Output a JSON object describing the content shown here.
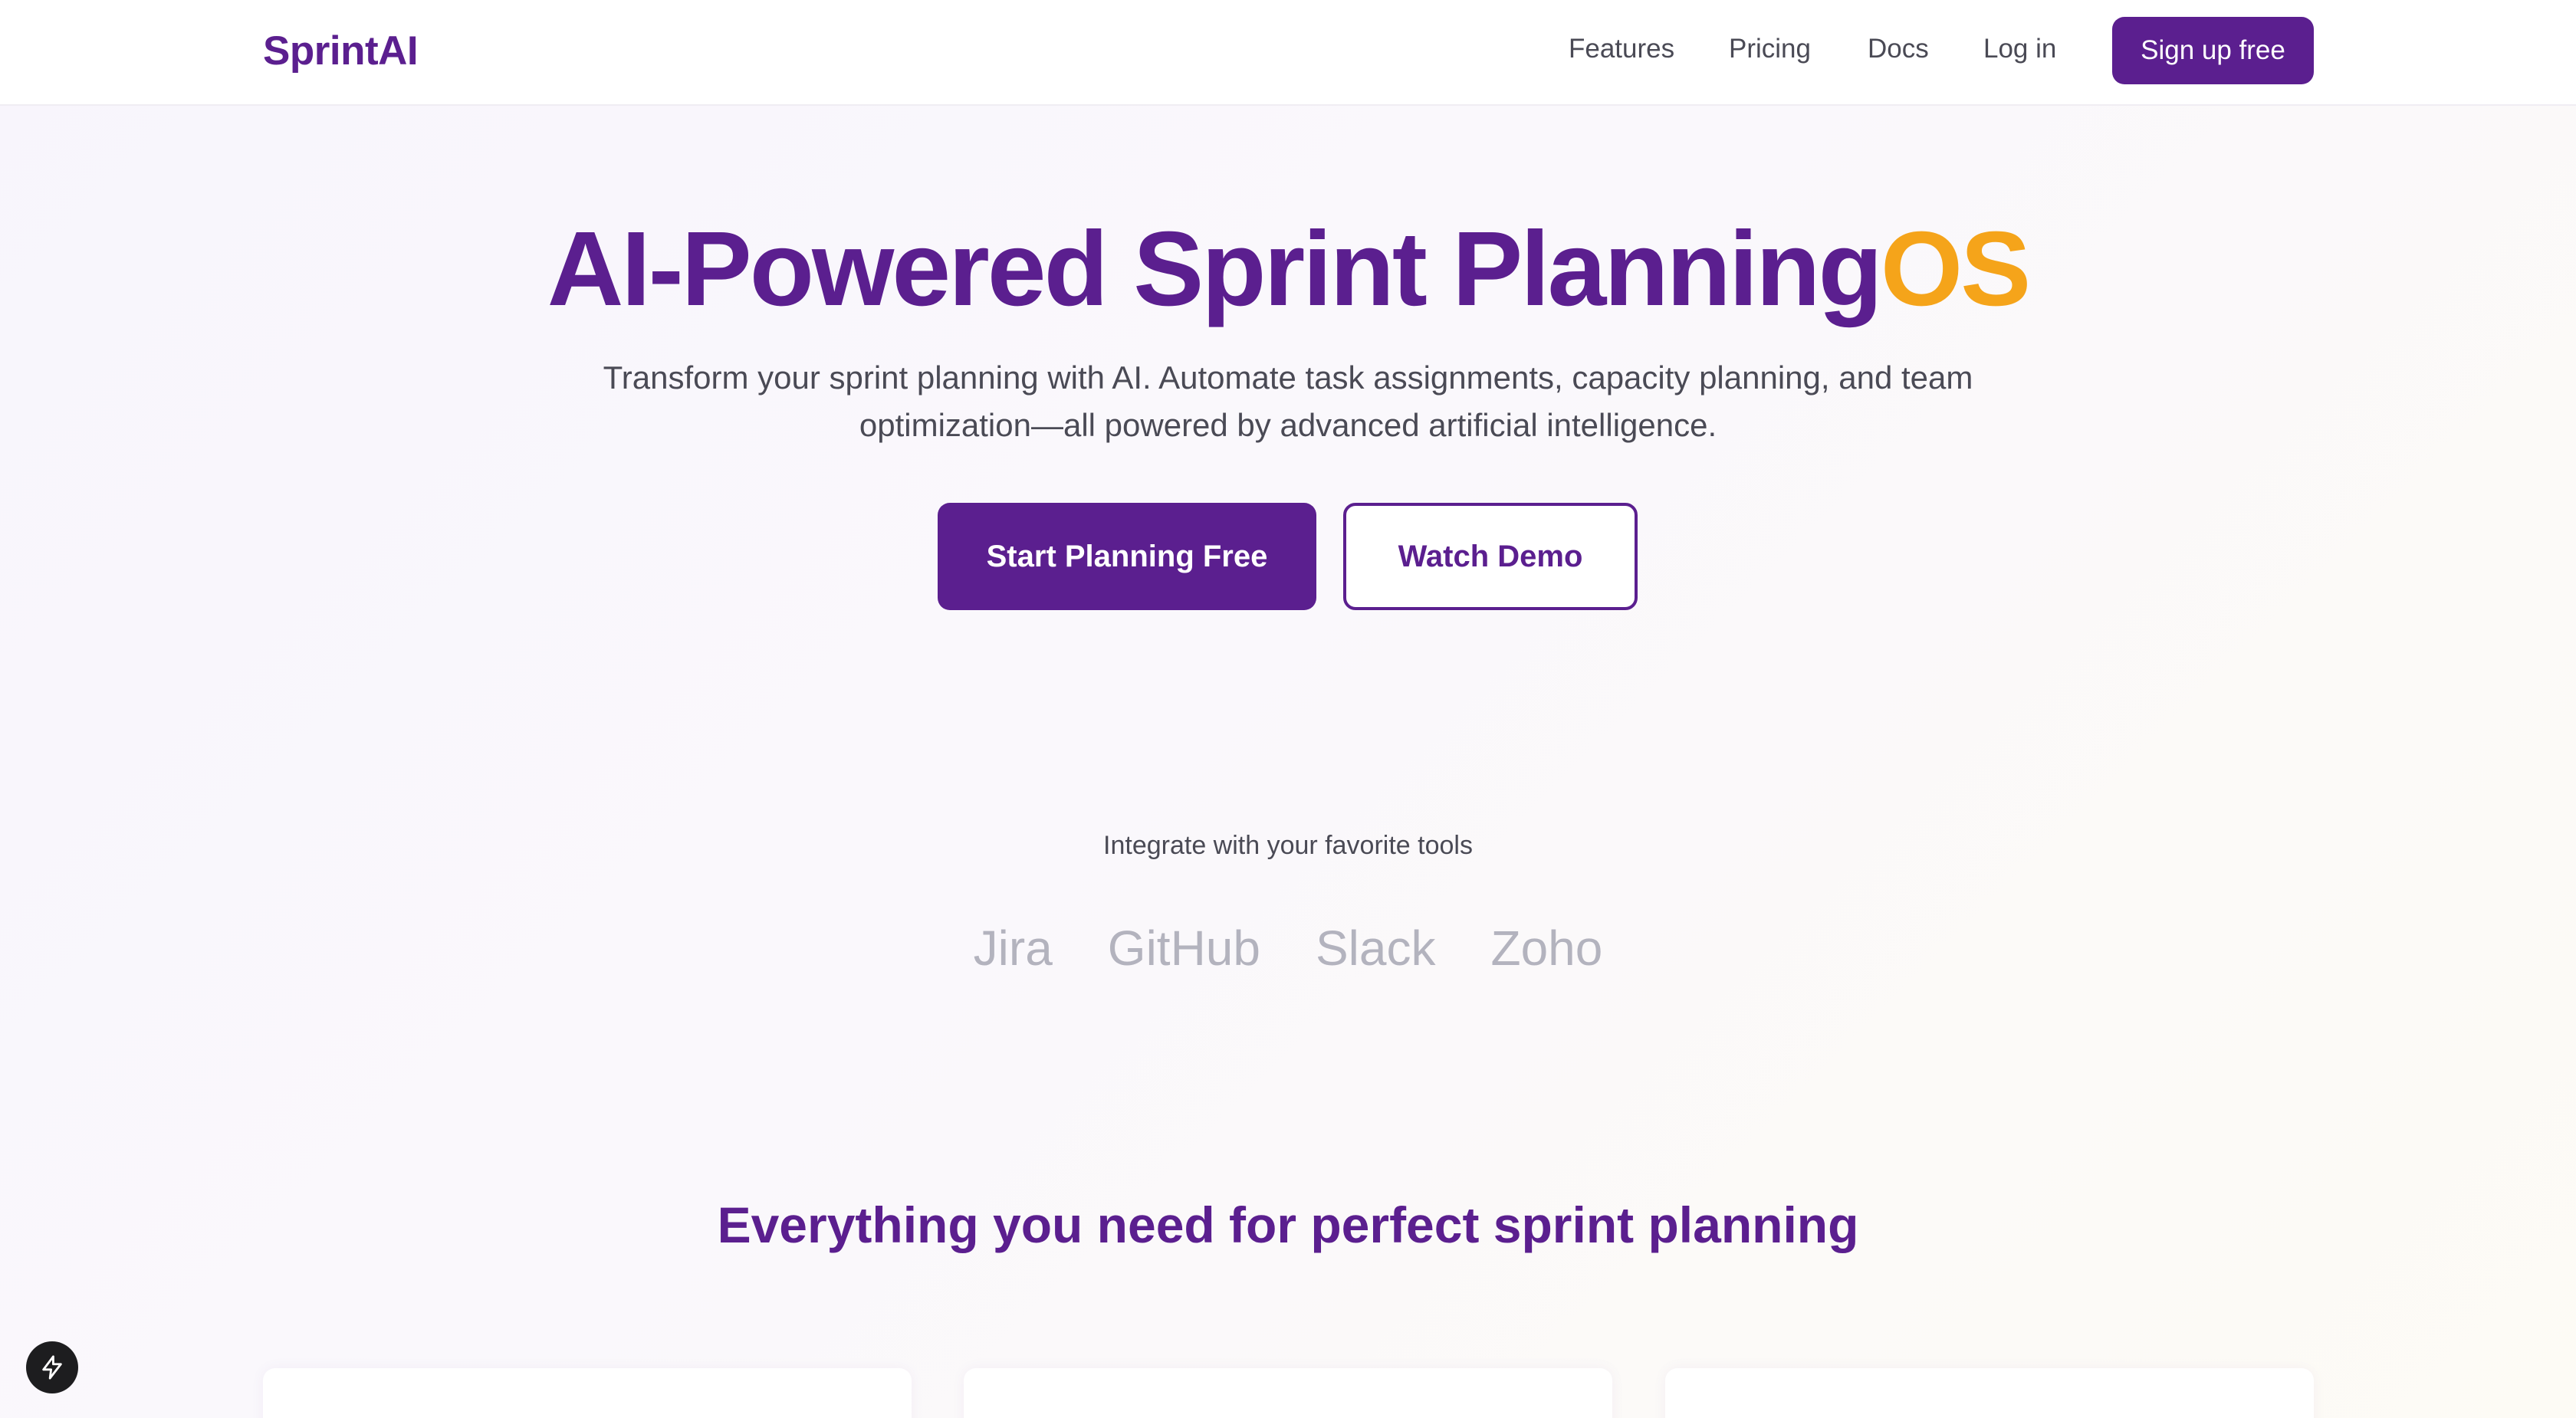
{
  "header": {
    "logo": "SprintAI",
    "nav": {
      "features": "Features",
      "pricing": "Pricing",
      "docs": "Docs",
      "login": "Log in",
      "signup": "Sign up free"
    }
  },
  "hero": {
    "title_main": "AI-Powered Sprint Planning",
    "title_accent": "OS",
    "subtitle": "Transform your sprint planning with AI. Automate task assignments, capacity planning, and team optimization—all powered by advanced artificial intelligence.",
    "primary_cta": "Start Planning Free",
    "secondary_cta": "Watch Demo"
  },
  "integrations": {
    "label": "Integrate with your favorite tools",
    "tools": [
      "Jira",
      "GitHub",
      "Slack",
      "Zoho"
    ]
  },
  "features": {
    "title": "Everything you need for perfect sprint planning"
  },
  "colors": {
    "brand": "#5b1f8f",
    "accent": "#f5a41a",
    "text": "#4a4a55",
    "muted": "#b3b3be"
  },
  "floating_button": {
    "icon": "lightning-icon"
  }
}
